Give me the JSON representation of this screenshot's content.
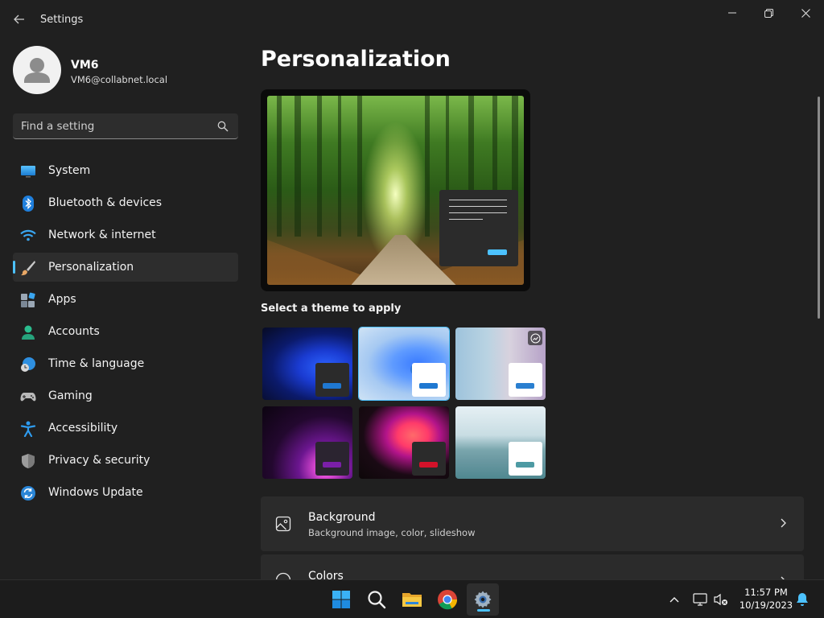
{
  "window": {
    "title": "Settings"
  },
  "profile": {
    "name": "VM6",
    "email": "VM6@collabnet.local"
  },
  "search": {
    "placeholder": "Find a setting"
  },
  "nav": {
    "items": [
      {
        "label": "System",
        "icon": "system-icon",
        "active": false
      },
      {
        "label": "Bluetooth & devices",
        "icon": "bluetooth-icon",
        "active": false
      },
      {
        "label": "Network & internet",
        "icon": "wifi-icon",
        "active": false
      },
      {
        "label": "Personalization",
        "icon": "brush-icon",
        "active": true
      },
      {
        "label": "Apps",
        "icon": "apps-icon",
        "active": false
      },
      {
        "label": "Accounts",
        "icon": "person-icon",
        "active": false
      },
      {
        "label": "Time & language",
        "icon": "globe-clock-icon",
        "active": false
      },
      {
        "label": "Gaming",
        "icon": "gamepad-icon",
        "active": false
      },
      {
        "label": "Accessibility",
        "icon": "accessibility-icon",
        "active": false
      },
      {
        "label": "Privacy & security",
        "icon": "shield-icon",
        "active": false
      },
      {
        "label": "Windows Update",
        "icon": "update-icon",
        "active": false
      }
    ]
  },
  "main": {
    "title": "Personalization",
    "themes_label": "Select a theme to apply",
    "settings": [
      {
        "title": "Background",
        "subtitle": "Background image, color, slideshow",
        "icon": "image-icon"
      },
      {
        "title": "Colors",
        "icon": "palette-icon"
      }
    ]
  },
  "colors": {
    "accent": "#4cc2ff",
    "background": "#202020",
    "card": "#2b2b2b"
  },
  "taskbar": {
    "apps": [
      "start-icon",
      "search-icon",
      "file-explorer-icon",
      "chrome-icon",
      "settings-icon"
    ],
    "time": "11:57 PM",
    "date": "10/19/2023"
  }
}
